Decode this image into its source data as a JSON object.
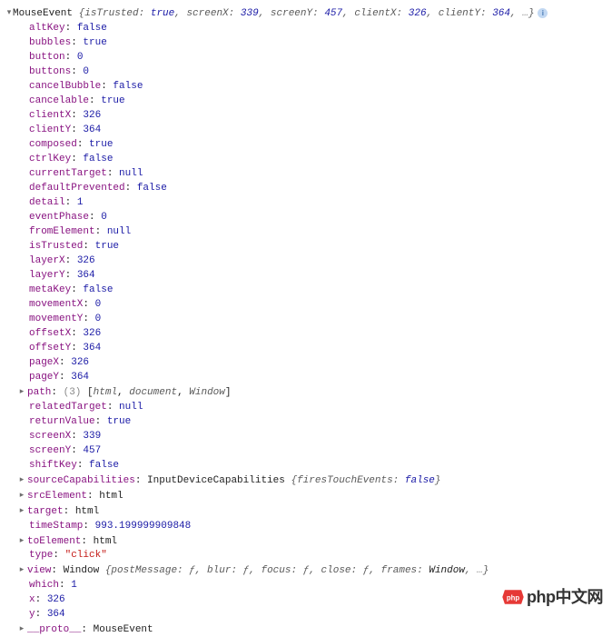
{
  "header": {
    "className": "MouseEvent",
    "summaryPairs": [
      {
        "k": "isTrusted",
        "v": "true",
        "t": "bool"
      },
      {
        "k": "screenX",
        "v": "339",
        "t": "num"
      },
      {
        "k": "screenY",
        "v": "457",
        "t": "num"
      },
      {
        "k": "clientX",
        "v": "326",
        "t": "num"
      },
      {
        "k": "clientY",
        "v": "364",
        "t": "num"
      }
    ],
    "ellipsis": "…"
  },
  "props": [
    {
      "key": "altKey",
      "value": "false",
      "type": "bool"
    },
    {
      "key": "bubbles",
      "value": "true",
      "type": "bool"
    },
    {
      "key": "button",
      "value": "0",
      "type": "num"
    },
    {
      "key": "buttons",
      "value": "0",
      "type": "num"
    },
    {
      "key": "cancelBubble",
      "value": "false",
      "type": "bool"
    },
    {
      "key": "cancelable",
      "value": "true",
      "type": "bool"
    },
    {
      "key": "clientX",
      "value": "326",
      "type": "num"
    },
    {
      "key": "clientY",
      "value": "364",
      "type": "num"
    },
    {
      "key": "composed",
      "value": "true",
      "type": "bool"
    },
    {
      "key": "ctrlKey",
      "value": "false",
      "type": "bool"
    },
    {
      "key": "currentTarget",
      "value": "null",
      "type": "nul"
    },
    {
      "key": "defaultPrevented",
      "value": "false",
      "type": "bool"
    },
    {
      "key": "detail",
      "value": "1",
      "type": "num"
    },
    {
      "key": "eventPhase",
      "value": "0",
      "type": "num"
    },
    {
      "key": "fromElement",
      "value": "null",
      "type": "nul"
    },
    {
      "key": "isTrusted",
      "value": "true",
      "type": "bool"
    },
    {
      "key": "layerX",
      "value": "326",
      "type": "num"
    },
    {
      "key": "layerY",
      "value": "364",
      "type": "num"
    },
    {
      "key": "metaKey",
      "value": "false",
      "type": "bool"
    },
    {
      "key": "movementX",
      "value": "0",
      "type": "num"
    },
    {
      "key": "movementY",
      "value": "0",
      "type": "num"
    },
    {
      "key": "offsetX",
      "value": "326",
      "type": "num"
    },
    {
      "key": "offsetY",
      "value": "364",
      "type": "num"
    },
    {
      "key": "pageX",
      "value": "326",
      "type": "num"
    },
    {
      "key": "pageY",
      "value": "364",
      "type": "num"
    },
    {
      "key": "path",
      "expandable": true,
      "arrLen": "(3)",
      "arrItems": [
        "html",
        "document",
        "Window"
      ]
    },
    {
      "key": "relatedTarget",
      "value": "null",
      "type": "nul"
    },
    {
      "key": "returnValue",
      "value": "true",
      "type": "bool"
    },
    {
      "key": "screenX",
      "value": "339",
      "type": "num"
    },
    {
      "key": "screenY",
      "value": "457",
      "type": "num"
    },
    {
      "key": "shiftKey",
      "value": "false",
      "type": "bool"
    },
    {
      "key": "sourceCapabilities",
      "expandable": true,
      "objClass": "InputDeviceCapabilities",
      "objPairs": [
        {
          "k": "firesTouchEvents",
          "v": "false",
          "t": "bool"
        }
      ]
    },
    {
      "key": "srcElement",
      "expandable": true,
      "value": "html",
      "type": "txt"
    },
    {
      "key": "target",
      "expandable": true,
      "value": "html",
      "type": "txt"
    },
    {
      "key": "timeStamp",
      "value": "993.199999909848",
      "type": "num"
    },
    {
      "key": "toElement",
      "expandable": true,
      "value": "html",
      "type": "txt"
    },
    {
      "key": "type",
      "value": "\"click\"",
      "type": "str"
    },
    {
      "key": "view",
      "expandable": true,
      "objClass": "Window",
      "objPairs": [
        {
          "k": "postMessage",
          "v": "ƒ",
          "t": "fn"
        },
        {
          "k": "blur",
          "v": "ƒ",
          "t": "fn"
        },
        {
          "k": "focus",
          "v": "ƒ",
          "t": "fn"
        },
        {
          "k": "close",
          "v": "ƒ",
          "t": "fn"
        },
        {
          "k": "frames",
          "v": "Window",
          "t": "txt"
        }
      ],
      "ellipsis": "…"
    },
    {
      "key": "which",
      "value": "1",
      "type": "num"
    },
    {
      "key": "x",
      "value": "326",
      "type": "num"
    },
    {
      "key": "y",
      "value": "364",
      "type": "num"
    },
    {
      "key": "__proto__",
      "expandable": true,
      "value": "MouseEvent",
      "type": "txt"
    }
  ],
  "watermark": {
    "text": "php中文网"
  }
}
